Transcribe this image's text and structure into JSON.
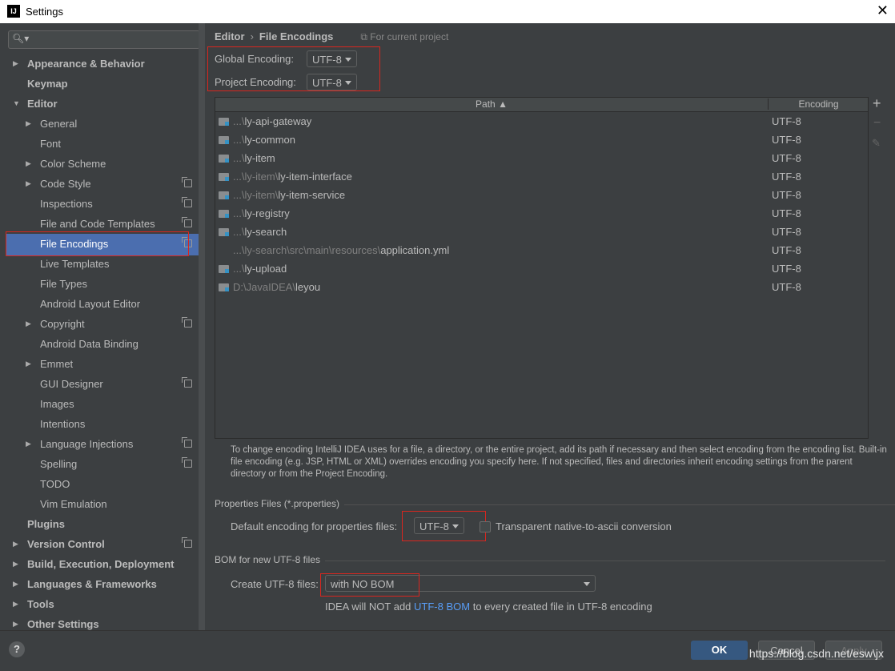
{
  "window": {
    "title": "Settings",
    "logo_text": "IJ"
  },
  "sidebar": {
    "items": [
      {
        "label": "Appearance & Behavior",
        "level": 0,
        "expandable": true,
        "expanded": false,
        "bold": true,
        "copy": false
      },
      {
        "label": "Keymap",
        "level": 0,
        "expandable": false,
        "bold": true,
        "copy": false
      },
      {
        "label": "Editor",
        "level": 0,
        "expandable": true,
        "expanded": true,
        "bold": true,
        "copy": false
      },
      {
        "label": "General",
        "level": 1,
        "expandable": true,
        "expanded": false,
        "copy": false
      },
      {
        "label": "Font",
        "level": 1,
        "expandable": false,
        "copy": false
      },
      {
        "label": "Color Scheme",
        "level": 1,
        "expandable": true,
        "expanded": false,
        "copy": false
      },
      {
        "label": "Code Style",
        "level": 1,
        "expandable": true,
        "expanded": false,
        "copy": true
      },
      {
        "label": "Inspections",
        "level": 1,
        "expandable": false,
        "copy": true
      },
      {
        "label": "File and Code Templates",
        "level": 1,
        "expandable": false,
        "copy": true
      },
      {
        "label": "File Encodings",
        "level": 1,
        "expandable": false,
        "copy": true,
        "selected": true
      },
      {
        "label": "Live Templates",
        "level": 1,
        "expandable": false,
        "copy": false
      },
      {
        "label": "File Types",
        "level": 1,
        "expandable": false,
        "copy": false
      },
      {
        "label": "Android Layout Editor",
        "level": 1,
        "expandable": false,
        "copy": false
      },
      {
        "label": "Copyright",
        "level": 1,
        "expandable": true,
        "expanded": false,
        "copy": true
      },
      {
        "label": "Android Data Binding",
        "level": 1,
        "expandable": false,
        "copy": false
      },
      {
        "label": "Emmet",
        "level": 1,
        "expandable": true,
        "expanded": false,
        "copy": false
      },
      {
        "label": "GUI Designer",
        "level": 1,
        "expandable": false,
        "copy": true
      },
      {
        "label": "Images",
        "level": 1,
        "expandable": false,
        "copy": false
      },
      {
        "label": "Intentions",
        "level": 1,
        "expandable": false,
        "copy": false
      },
      {
        "label": "Language Injections",
        "level": 1,
        "expandable": true,
        "expanded": false,
        "copy": true
      },
      {
        "label": "Spelling",
        "level": 1,
        "expandable": false,
        "copy": true
      },
      {
        "label": "TODO",
        "level": 1,
        "expandable": false,
        "copy": false
      },
      {
        "label": "Vim Emulation",
        "level": 1,
        "expandable": false,
        "copy": false
      },
      {
        "label": "Plugins",
        "level": 0,
        "expandable": false,
        "bold": true,
        "copy": false
      },
      {
        "label": "Version Control",
        "level": 0,
        "expandable": true,
        "expanded": false,
        "bold": true,
        "copy": true
      },
      {
        "label": "Build, Execution, Deployment",
        "level": 0,
        "expandable": true,
        "expanded": false,
        "bold": true,
        "copy": false
      },
      {
        "label": "Languages & Frameworks",
        "level": 0,
        "expandable": true,
        "expanded": false,
        "bold": true,
        "copy": false
      },
      {
        "label": "Tools",
        "level": 0,
        "expandable": true,
        "expanded": false,
        "bold": true,
        "copy": false
      },
      {
        "label": "Other Settings",
        "level": 0,
        "expandable": true,
        "expanded": false,
        "bold": true,
        "copy": false
      }
    ]
  },
  "breadcrumb": {
    "parent": "Editor",
    "separator": "›",
    "current": "File Encodings",
    "scope": "For current project"
  },
  "encodings": {
    "global_label": "Global Encoding:",
    "global_value": "UTF-8",
    "project_label": "Project Encoding:",
    "project_value": "UTF-8"
  },
  "table": {
    "columns": {
      "path": "Path ▲",
      "encoding": "Encoding"
    },
    "rows": [
      {
        "prefix": "...\\",
        "name": "ly-api-gateway",
        "encoding": "UTF-8",
        "folder": true
      },
      {
        "prefix": "...\\",
        "name": "ly-common",
        "encoding": "UTF-8",
        "folder": true
      },
      {
        "prefix": "...\\",
        "name": "ly-item",
        "encoding": "UTF-8",
        "folder": true
      },
      {
        "prefix": "...\\ly-item\\",
        "name": "ly-item-interface",
        "encoding": "UTF-8",
        "folder": true
      },
      {
        "prefix": "...\\ly-item\\",
        "name": "ly-item-service",
        "encoding": "UTF-8",
        "folder": true
      },
      {
        "prefix": "...\\",
        "name": "ly-registry",
        "encoding": "UTF-8",
        "folder": true
      },
      {
        "prefix": "...\\",
        "name": "ly-search",
        "encoding": "UTF-8",
        "folder": true
      },
      {
        "prefix": "...\\ly-search\\src\\main\\resources\\",
        "name": "application.yml",
        "encoding": "UTF-8",
        "folder": false
      },
      {
        "prefix": "...\\",
        "name": "ly-upload",
        "encoding": "UTF-8",
        "folder": true
      },
      {
        "prefix": "D:\\JavaIDEA\\",
        "name": "leyou",
        "encoding": "UTF-8",
        "folder": true
      }
    ],
    "add_icon": "+",
    "remove_icon": "−",
    "edit_icon": "✎"
  },
  "info_text": "To change encoding IntelliJ IDEA uses for a file, a directory, or the entire project, add its path if necessary and then select encoding from the encoding list. Built-in file encoding (e.g. JSP, HTML or XML) overrides encoding you specify here. If not specified, files and directories inherit encoding settings from the parent directory or from the Project Encoding.",
  "properties": {
    "section": "Properties Files (*.properties)",
    "default_label": "Default encoding for properties files:",
    "default_value": "UTF-8",
    "transparent_label": "Transparent native-to-ascii conversion",
    "transparent_checked": false
  },
  "bom": {
    "section": "BOM for new UTF-8 files",
    "create_label": "Create UTF-8 files:",
    "create_value": "with NO BOM",
    "note_prefix": "IDEA will NOT add ",
    "note_link": "UTF-8 BOM",
    "note_suffix": " to every created file in UTF-8 encoding"
  },
  "buttons": {
    "help": "?",
    "ok": "OK",
    "cancel": "Cancel",
    "apply": "Apply"
  },
  "watermark": "https://blog.csdn.net/esw\\jx",
  "colors": {
    "accent": "#4b6eaf",
    "highlight": "#d9261f",
    "link": "#589df6",
    "ok_button": "#365880"
  }
}
